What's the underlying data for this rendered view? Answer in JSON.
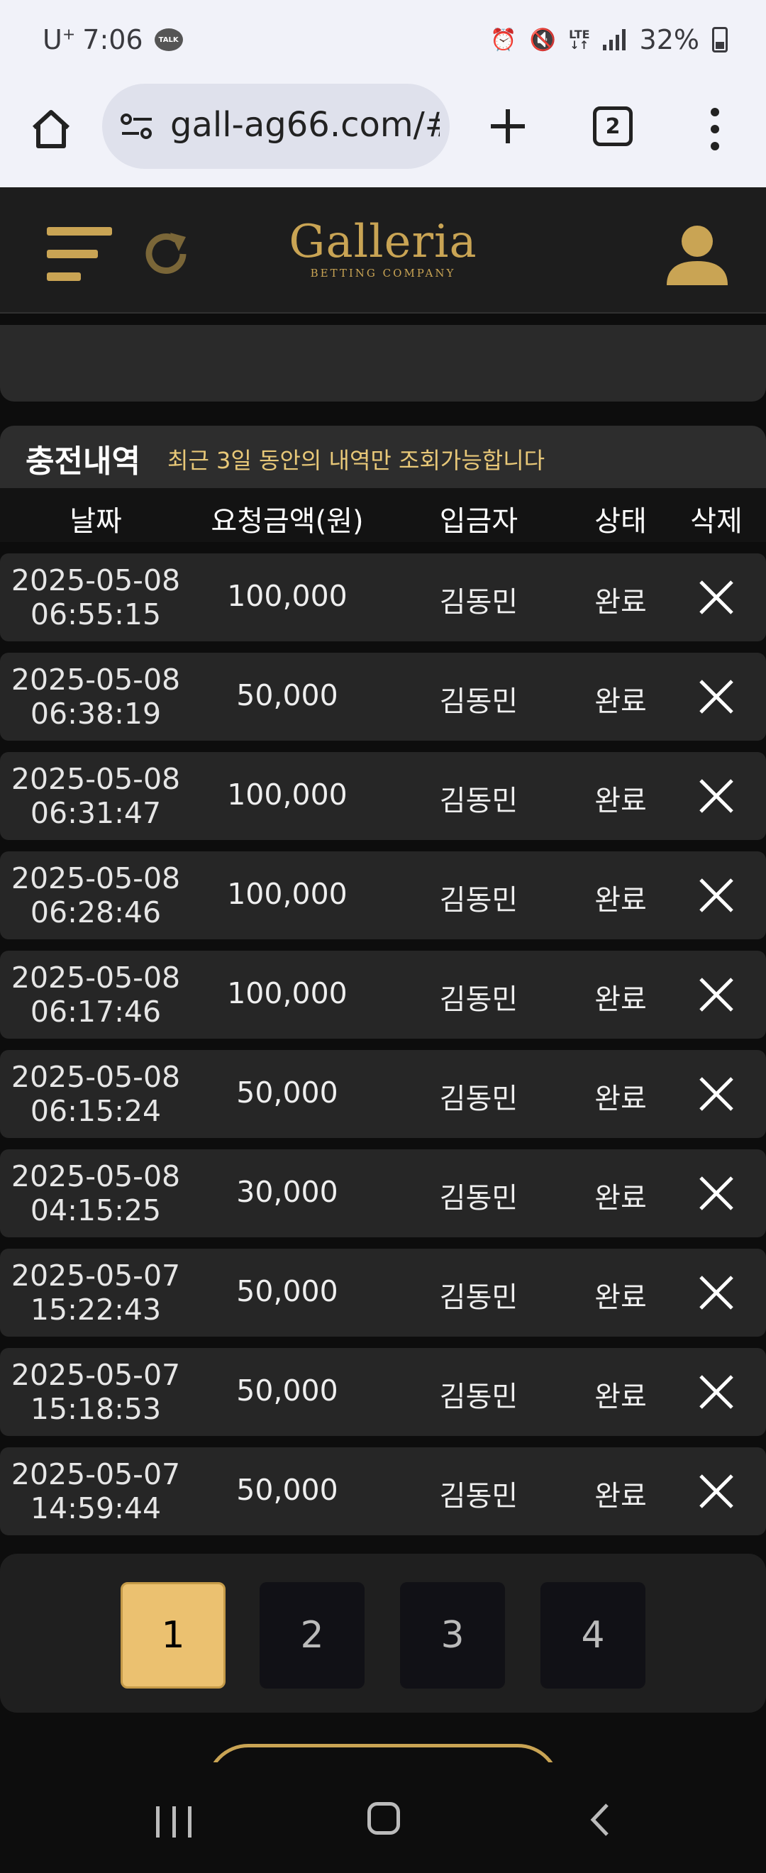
{
  "status_bar": {
    "carrier": "U",
    "carrier_sup": "+",
    "time": "7:06",
    "talk": "TALK",
    "lte_top": "LTE",
    "lte_bottom": "↓↑",
    "battery": "32%"
  },
  "browser": {
    "url": "gall-ag66.com/#",
    "tab_count": "2"
  },
  "site": {
    "logo_name": "Galleria",
    "logo_sub": "BETTING COMPANY"
  },
  "section": {
    "title": "충전내역",
    "note": "최근 3일 동안의 내역만 조회가능합니다"
  },
  "table": {
    "headers": {
      "date": "날짜",
      "amount": "요청금액(원)",
      "depositor": "입금자",
      "status": "상태",
      "delete": "삭제"
    },
    "rows": [
      {
        "date": "2025-05-08",
        "time": "06:55:15",
        "amount": "100,000",
        "depositor": "김동민",
        "status": "완료"
      },
      {
        "date": "2025-05-08",
        "time": "06:38:19",
        "amount": "50,000",
        "depositor": "김동민",
        "status": "완료"
      },
      {
        "date": "2025-05-08",
        "time": "06:31:47",
        "amount": "100,000",
        "depositor": "김동민",
        "status": "완료"
      },
      {
        "date": "2025-05-08",
        "time": "06:28:46",
        "amount": "100,000",
        "depositor": "김동민",
        "status": "완료"
      },
      {
        "date": "2025-05-08",
        "time": "06:17:46",
        "amount": "100,000",
        "depositor": "김동민",
        "status": "완료"
      },
      {
        "date": "2025-05-08",
        "time": "06:15:24",
        "amount": "50,000",
        "depositor": "김동민",
        "status": "완료"
      },
      {
        "date": "2025-05-08",
        "time": "04:15:25",
        "amount": "30,000",
        "depositor": "김동민",
        "status": "완료"
      },
      {
        "date": "2025-05-07",
        "time": "15:22:43",
        "amount": "50,000",
        "depositor": "김동민",
        "status": "완료"
      },
      {
        "date": "2025-05-07",
        "time": "15:18:53",
        "amount": "50,000",
        "depositor": "김동민",
        "status": "완료"
      },
      {
        "date": "2025-05-07",
        "time": "14:59:44",
        "amount": "50,000",
        "depositor": "김동민",
        "status": "완료"
      }
    ]
  },
  "pagination": {
    "pages": [
      "1",
      "2",
      "3",
      "4"
    ],
    "current": "1"
  },
  "colors": {
    "gold": "#c9a454",
    "active_page": "#ebc170",
    "note_text": "#e8c878"
  },
  "icons": [
    "home-icon",
    "site-settings-icon",
    "plus-icon",
    "more-vert-icon",
    "hamburger-icon",
    "refresh-icon",
    "user-icon",
    "close-icon"
  ]
}
